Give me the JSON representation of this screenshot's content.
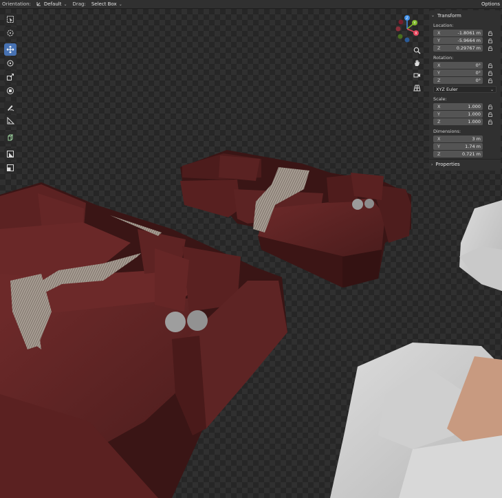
{
  "header": {
    "orientation_label": "Orientation:",
    "orientation_value": "Default",
    "drag_label": "Drag:",
    "drag_value": "Select Box",
    "options_label": "Options"
  },
  "gizmo": {
    "x_label": "X",
    "y_label": "Y",
    "z_label": "Z",
    "colors": {
      "x": "#e5455c",
      "y": "#7fb82b",
      "z": "#3d8ee8"
    }
  },
  "toolbar": {
    "tools": [
      "select-box-icon",
      "cursor-icon",
      "move-icon",
      "rotate-icon",
      "scale-icon",
      "transform-icon",
      "annotate-icon",
      "measure-icon",
      "add-cube-icon",
      "shade-icon",
      "extrude-icon"
    ],
    "active": "move-icon"
  },
  "transform": {
    "title": "Transform",
    "location_label": "Location:",
    "location": [
      {
        "axis": "X",
        "value": "-1.8061 m"
      },
      {
        "axis": "Y",
        "value": "-5.9664 m"
      },
      {
        "axis": "Z",
        "value": "0.29767 m"
      }
    ],
    "rotation_label": "Rotation:",
    "rotation": [
      {
        "axis": "X",
        "value": "0°"
      },
      {
        "axis": "Y",
        "value": "0°"
      },
      {
        "axis": "Z",
        "value": "0°"
      }
    ],
    "rotation_mode": "XYZ Euler",
    "scale_label": "Scale:",
    "scale": [
      {
        "axis": "X",
        "value": "1.000"
      },
      {
        "axis": "Y",
        "value": "1.000"
      },
      {
        "axis": "Z",
        "value": "1.000"
      }
    ],
    "dimensions_label": "Dimensions:",
    "dimensions": [
      {
        "axis": "X",
        "value": "3 m"
      },
      {
        "axis": "Y",
        "value": "1.74 m"
      },
      {
        "axis": "Z",
        "value": "0.721 m"
      }
    ]
  },
  "properties": {
    "title": "Properties"
  }
}
